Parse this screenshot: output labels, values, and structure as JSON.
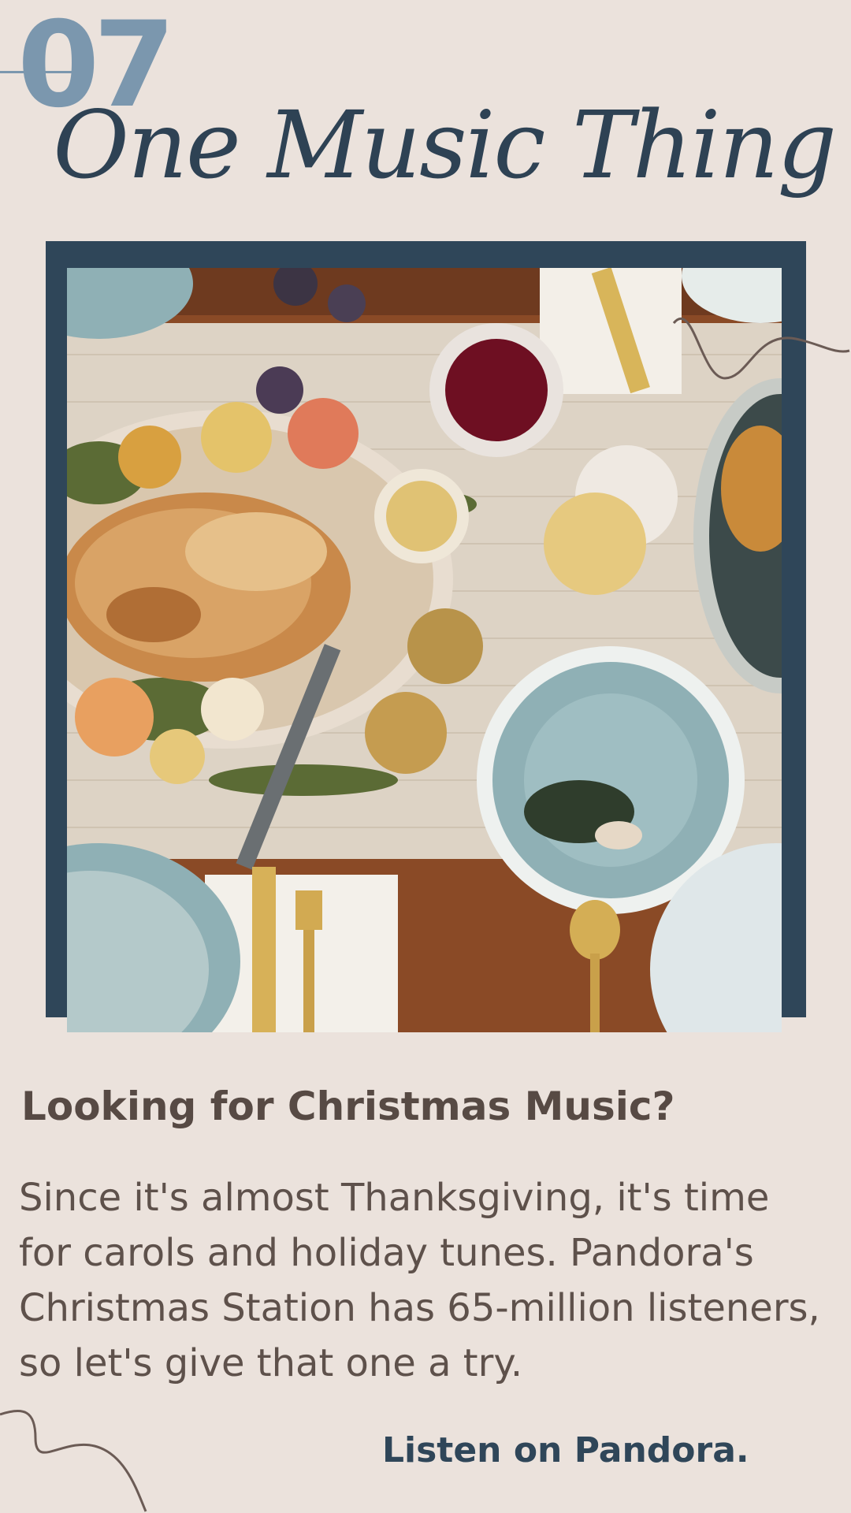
{
  "header": {
    "number": "07",
    "title": "One Music Thing"
  },
  "article": {
    "heading": "Looking for Christmas Music?",
    "body": "Since it's almost Thanksgiving, it's time for carols and holiday tunes.  Pandora's Christmas Station has 65-million listeners, so let's give that one a try.",
    "cta": "Listen on Pandora."
  },
  "colors": {
    "background": "#ebe2dc",
    "frame": "#2f4659",
    "number": "#7b97ae",
    "text": "#5e514b"
  }
}
